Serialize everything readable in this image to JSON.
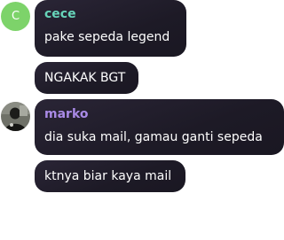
{
  "messages": [
    {
      "sender": "cece",
      "avatar_letter": "C",
      "name_color": "#67d5ba",
      "avatar_color": "#7dd36a",
      "lines": [
        "pake sepeda legend",
        "NGAKAK BGT"
      ]
    },
    {
      "sender": "marko",
      "name_color": "#a98ae6",
      "avatar_icon": "profile-photo-icon",
      "lines": [
        "dia suka mail, gamau ganti sepeda",
        "ktnya biar kaya mail"
      ]
    }
  ]
}
